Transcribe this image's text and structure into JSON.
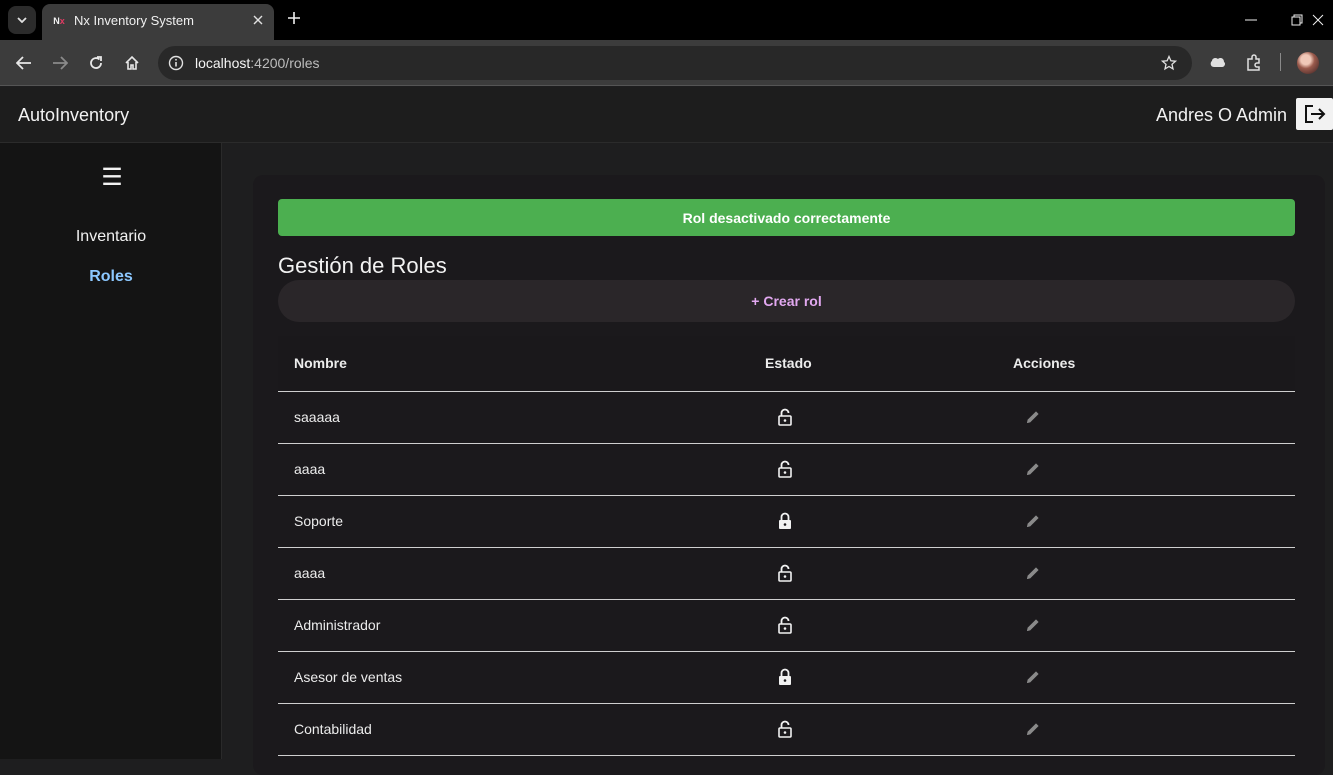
{
  "browser": {
    "tab_title": "Nx Inventory System",
    "tab_favicon": "nx-logo-icon",
    "url_host": "localhost",
    "url_path": ":4200/roles"
  },
  "app": {
    "brand": "AutoInventory",
    "user_name": "Andres O Admin"
  },
  "sidebar": {
    "items": [
      {
        "label": "Inventario",
        "active": false
      },
      {
        "label": "Roles",
        "active": true
      }
    ]
  },
  "main": {
    "toast": "Rol desactivado correctamente",
    "toast_color": "#4caf50",
    "title": "Gestión de Roles",
    "create_label": "+ Crear rol",
    "table": {
      "headers": [
        "Nombre",
        "Estado",
        "Acciones"
      ],
      "rows": [
        {
          "name": "saaaaa",
          "status_icon": "lock-open-icon"
        },
        {
          "name": "aaaa",
          "status_icon": "lock-open-icon"
        },
        {
          "name": "Soporte",
          "status_icon": "lock-closed-icon"
        },
        {
          "name": "aaaa",
          "status_icon": "lock-open-icon"
        },
        {
          "name": "Administrador",
          "status_icon": "lock-open-icon"
        },
        {
          "name": "Asesor de ventas",
          "status_icon": "lock-closed-icon"
        },
        {
          "name": "Contabilidad",
          "status_icon": "lock-open-icon"
        }
      ],
      "action_icon": "edit-icon"
    }
  }
}
